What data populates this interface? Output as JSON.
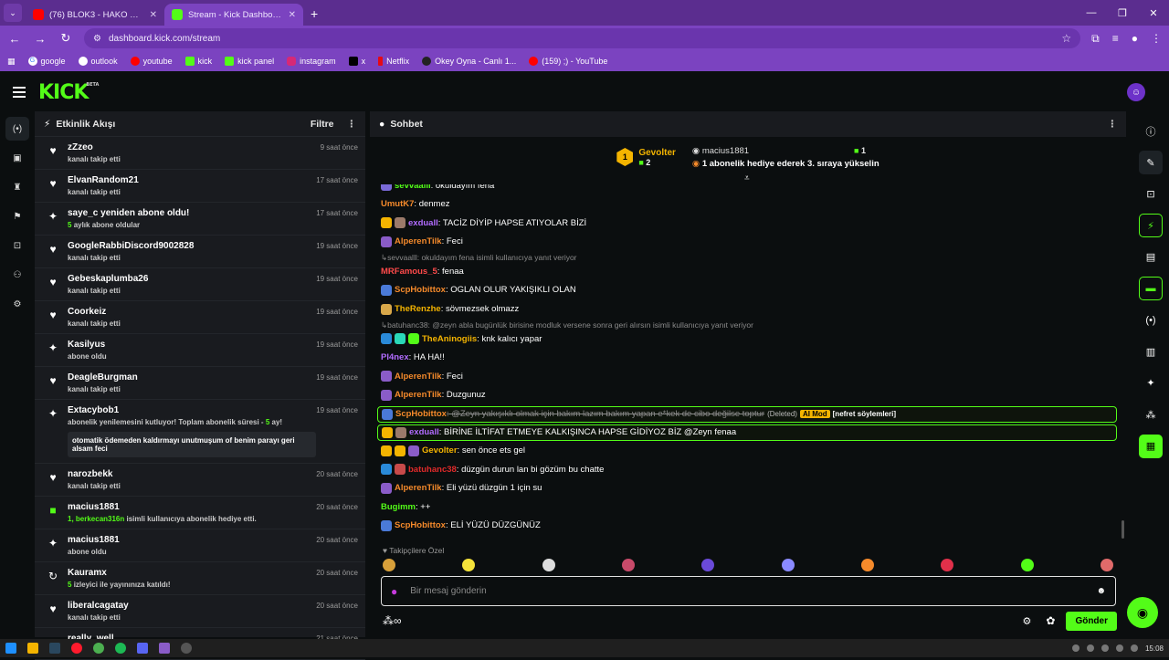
{
  "browser": {
    "tabs": [
      {
        "label": "(76) BLOK3 - HAKO DİYORLAR",
        "active": false
      },
      {
        "label": "Stream - Kick Dashboard",
        "active": true
      }
    ],
    "new_tab": "+",
    "url": "dashboard.kick.com/stream",
    "bookmarks": [
      {
        "label": "google"
      },
      {
        "label": "outlook"
      },
      {
        "label": "youtube"
      },
      {
        "label": "kick"
      },
      {
        "label": "kick panel"
      },
      {
        "label": "instagram"
      },
      {
        "label": "x"
      },
      {
        "label": "Netflix"
      },
      {
        "label": "Okey Oyna - Canlı 1..."
      },
      {
        "label": "(159) ;) - YouTube"
      }
    ]
  },
  "header": {
    "logo": "KICK",
    "logo_sup": "BETA"
  },
  "feed": {
    "title": "Etkinlik Akışı",
    "filter_label": "Filtre",
    "events": [
      {
        "icon": "heart",
        "name": "zZzeo",
        "sub": "kanalı takip etti",
        "time": "9 saat önce"
      },
      {
        "icon": "heart",
        "name": "ElvanRandom21",
        "sub": "kanalı takip etti",
        "time": "17 saat önce"
      },
      {
        "icon": "sparkle",
        "name": "saye_c yeniden abone oldu!",
        "sub_num": "5",
        "sub": "aylık abone oldular",
        "time": "17 saat önce"
      },
      {
        "icon": "heart",
        "name": "GoogleRabbiDiscord9002828",
        "sub": "kanalı takip etti",
        "time": "19 saat önce"
      },
      {
        "icon": "heart",
        "name": "Gebeskaplumba26",
        "sub": "kanalı takip etti",
        "time": "19 saat önce"
      },
      {
        "icon": "heart",
        "name": "Coorkeiz",
        "sub": "kanalı takip etti",
        "time": "19 saat önce"
      },
      {
        "icon": "sparkle",
        "name": "Kasilyus",
        "sub": "abone oldu",
        "time": "19 saat önce"
      },
      {
        "icon": "heart",
        "name": "DeagleBurgman",
        "sub": "kanalı takip etti",
        "time": "19 saat önce"
      },
      {
        "icon": "sparkle",
        "name": "Extacybob1",
        "sub": "abonelik yenilemesini kutluyor! Toplam abonelik süresi -",
        "sub_num": "5",
        "sub_tail": "ay!",
        "message": "otomatik ödemeden kaldırmayı unutmuşum of benim parayı geri alsam feci",
        "time": "19 saat önce"
      },
      {
        "icon": "heart",
        "name": "narozbekk",
        "sub": "kanalı takip etti",
        "time": "20 saat önce"
      },
      {
        "icon": "gift",
        "name": "macius1881",
        "sub_num": "1, berkecan316n",
        "sub": "isimli kullanıcıya abonelik hediye etti.",
        "time": "20 saat önce"
      },
      {
        "icon": "sparkle",
        "name": "macius1881",
        "sub": "abone oldu",
        "time": "20 saat önce"
      },
      {
        "icon": "host",
        "name": "Kauramx",
        "sub_num": "5",
        "sub": "izleyici ile yayınınıza katıldı!",
        "time": "20 saat önce"
      },
      {
        "icon": "heart",
        "name": "liberalcagatay",
        "sub": "kanalı takip etti",
        "time": "20 saat önce"
      },
      {
        "icon": "heart",
        "name": "really_well",
        "sub": "",
        "time": "21 saat önce"
      }
    ]
  },
  "chat": {
    "title": "Sohbet",
    "pinned": {
      "left_badge": "1",
      "left_name": "Gevolter",
      "left_count": "2",
      "right_user": "macius1881",
      "right_count": "1",
      "right_text": "1 abonelik hediye ederek 3. sıraya yükselin"
    },
    "messages": [
      {
        "user": "sevvaalll",
        "color": "#53fc18",
        "text": ": okuldayım fena",
        "badges": [
          "#7a6ad8"
        ],
        "cut": true
      },
      {
        "user": "UmutK7",
        "color": "#f58a2b",
        "text": ": denmez",
        "badges": []
      },
      {
        "user": "exdualI",
        "color": "#b26cff",
        "text": ": TACİZ DİYİP HAPSE ATIYOLAR BİZİ",
        "badges": [
          "#f4b400",
          "#9b7a6a"
        ]
      },
      {
        "user": "AlperenTilk",
        "color": "#f58a2b",
        "text": ": Feci",
        "badges": [
          "#8a5cc8"
        ]
      },
      {
        "reply": "sevvaalll: okuldayım fena isimli kullanıcıya yanıt veriyor"
      },
      {
        "user": "MRFamous_5",
        "color": "#ff4a4a",
        "text": ": fenaa",
        "badges": []
      },
      {
        "user": "ScpHobittox",
        "color": "#f58a2b",
        "text": ": OGLAN OLUR YAKIŞIKLI OLAN",
        "badges": [
          "#4a7ad8"
        ]
      },
      {
        "user": "TheRenzhe",
        "color": "#f4b400",
        "text": ": sövmezsek olmazz",
        "badges": [
          "#d8a84a"
        ]
      },
      {
        "reply": "batuhanc38: @zeyn abla bugünlük birisine modluk versene sonra geri alırsın isimli kullanıcıya yanıt veriyor"
      },
      {
        "user": "TheAninogiis",
        "color": "#f4b400",
        "text": ": knk kalıcı yapar",
        "badges": [
          "#2a8ad8",
          "#2ad8b8",
          "#53fc18"
        ]
      },
      {
        "user": "Pl4nex",
        "color": "#b26cff",
        "text": ": HA HA!!",
        "badges": []
      },
      {
        "user": "AlperenTilk",
        "color": "#f58a2b",
        "text": ": Feci",
        "badges": [
          "#8a5cc8"
        ]
      },
      {
        "user": "AlperenTilk",
        "color": "#f58a2b",
        "text": ": Duzgunuz",
        "badges": [
          "#8a5cc8"
        ]
      },
      {
        "user": "ScpHobittox",
        "color": "#f58a2b",
        "deleted": ": @Zeyn yakışıklı olmak için bakım lazım bakım yapan e*kek de cibo değilse toptur",
        "deleted_tag": "(Deleted)",
        "aimod": "AI Mod",
        "chip": "[nefret söylemleri]",
        "badges": [
          "#4a7ad8"
        ],
        "hl": true
      },
      {
        "user": "exdualI",
        "color": "#b26cff",
        "text": ": BİRİNE İLTİFAT ETMEYE KALKIŞINCA HAPSE GİDİYOZ BİZ @Zeyn fenaa",
        "badges": [
          "#f4b400",
          "#9b7a6a"
        ],
        "hl": true
      },
      {
        "user": "Gevolter",
        "color": "#f4b400",
        "text": ": sen önce ets gel",
        "badges": [
          "#f4b400",
          "#f4b400",
          "#8a5cc8"
        ]
      },
      {
        "user": "batuhanc38",
        "color": "#e02a2a",
        "text": ": düzgün durun lan bi gözüm bu chatte",
        "badges": [
          "#2a8ad8",
          "#c84a4a"
        ]
      },
      {
        "user": "AlperenTilk",
        "color": "#f58a2b",
        "text": ": Eli yüzü düzgün 1 için su",
        "badges": [
          "#8a5cc8"
        ]
      },
      {
        "user": "Bugimm",
        "color": "#53fc18",
        "text": ": ++",
        "badges": []
      },
      {
        "user": "ScpHobittox",
        "color": "#f58a2b",
        "text": ": ELİ YÜZÜ DÜZGÜNÜZ",
        "badges": [
          "#4a7ad8"
        ]
      }
    ],
    "follower_only": "Takipçilere Özel",
    "input_placeholder": "Bir mesaj gönderin",
    "send_label": "Gönder"
  },
  "taskbar": {
    "time": "15:08"
  },
  "colors": {
    "accent": "#53fc18",
    "browser": "#7b43c0"
  }
}
